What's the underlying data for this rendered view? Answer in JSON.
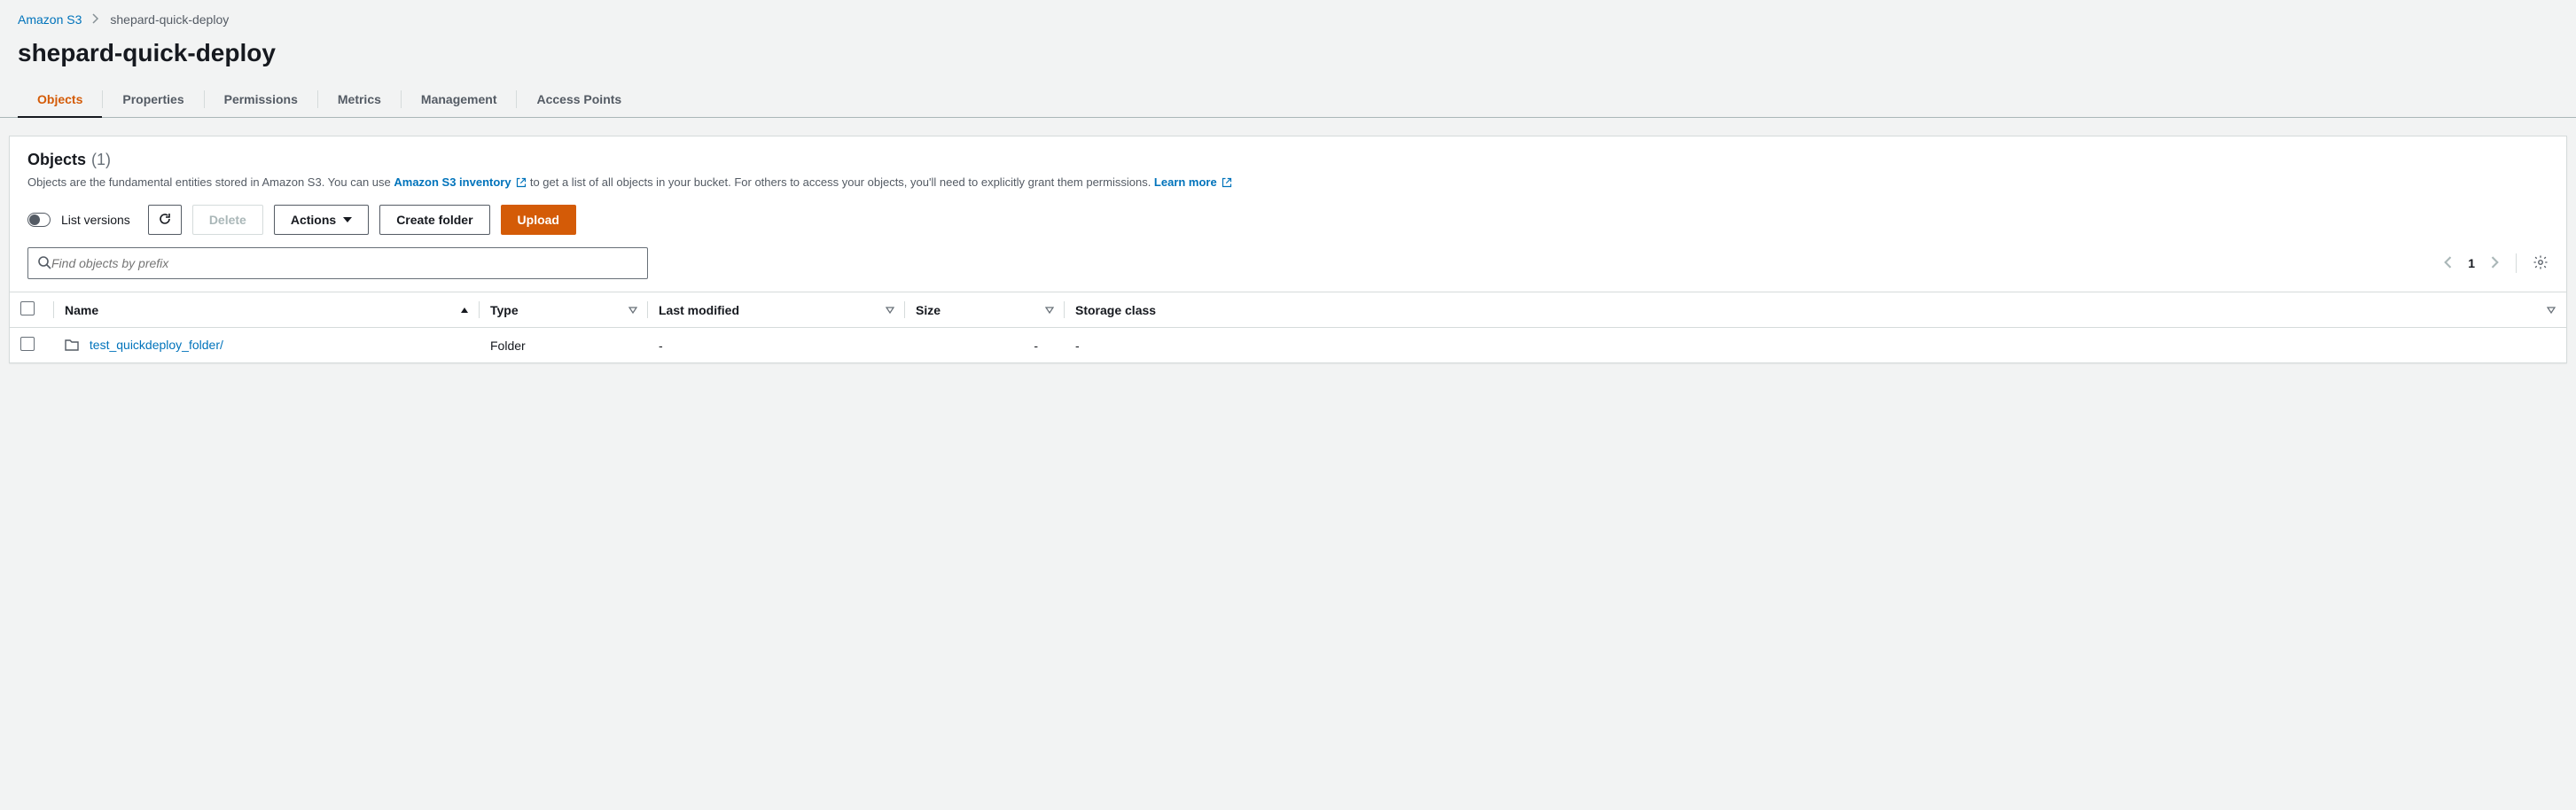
{
  "breadcrumb": {
    "root": "Amazon S3",
    "current": "shepard-quick-deploy"
  },
  "page": {
    "title": "shepard-quick-deploy"
  },
  "tabs": [
    {
      "label": "Objects",
      "active": true
    },
    {
      "label": "Properties",
      "active": false
    },
    {
      "label": "Permissions",
      "active": false
    },
    {
      "label": "Metrics",
      "active": false
    },
    {
      "label": "Management",
      "active": false
    },
    {
      "label": "Access Points",
      "active": false
    }
  ],
  "panel": {
    "title": "Objects",
    "count": "(1)",
    "desc_pre": "Objects are the fundamental entities stored in Amazon S3. You can use ",
    "link1": "Amazon S3 inventory",
    "desc_mid": " to get a list of all objects in your bucket. For others to access your objects, you'll need to explicitly grant them permissions. ",
    "link2": "Learn more"
  },
  "toolbar": {
    "list_versions": "List versions",
    "delete": "Delete",
    "actions": "Actions",
    "create_folder": "Create folder",
    "upload": "Upload"
  },
  "search": {
    "placeholder": "Find objects by prefix"
  },
  "pagination": {
    "page": "1"
  },
  "table": {
    "headers": {
      "name": "Name",
      "type": "Type",
      "last_modified": "Last modified",
      "size": "Size",
      "storage_class": "Storage class"
    },
    "rows": [
      {
        "name": "test_quickdeploy_folder/",
        "type": "Folder",
        "last_modified": "-",
        "size": "-",
        "storage_class": "-"
      }
    ]
  }
}
